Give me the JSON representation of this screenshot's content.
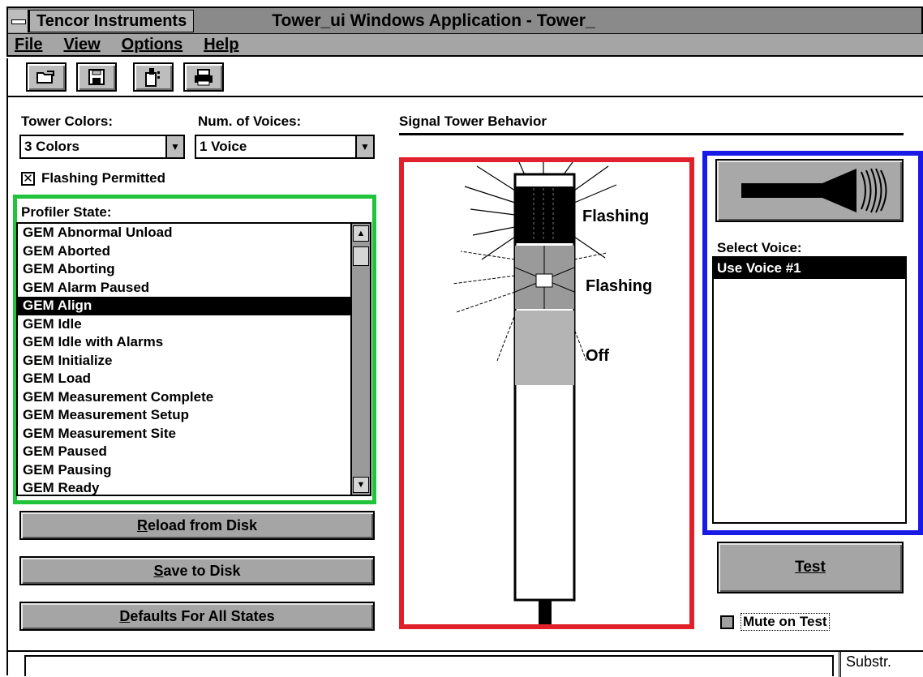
{
  "window": {
    "app_name": "Tencor Instruments",
    "title": "Tower_ui Windows Application - Tower_"
  },
  "menu": [
    "File",
    "View",
    "Options",
    "Help"
  ],
  "toolbar_icons": [
    "open-folder-icon",
    "save-disk-icon",
    "tower-icon",
    "printer-icon"
  ],
  "left": {
    "tower_colors_label": "Tower Colors:",
    "tower_colors_value": "3 Colors",
    "voices_label": "Num. of Voices:",
    "voices_value": "1 Voice",
    "flashing_label": "Flashing Permitted",
    "flashing_checked": true,
    "profiler_label": "Profiler State:",
    "states": [
      "GEM Abnormal Unload",
      "GEM Aborted",
      "GEM Aborting",
      "GEM Alarm Paused",
      "GEM Align",
      "GEM Idle",
      "GEM Idle with Alarms",
      "GEM Initialize",
      "GEM Load",
      "GEM Measurement Complete",
      "GEM Measurement Setup",
      "GEM Measurement Site",
      "GEM Paused",
      "GEM Pausing",
      "GEM Ready"
    ],
    "selected_state": "GEM Align",
    "reload_label_u": "R",
    "reload_label": "eload from Disk",
    "save_label_u": "S",
    "save_label": "ave to Disk",
    "defaults_label_u": "D",
    "defaults_label": "efaults For All States"
  },
  "tower": {
    "section_title": "Signal Tower Behavior",
    "lights": [
      {
        "state": "Flashing",
        "color": "#000000"
      },
      {
        "state": "Flashing",
        "color": "#9a9a9a"
      },
      {
        "state": "Off",
        "color": "#b4b4b4"
      }
    ]
  },
  "voice": {
    "select_label": "Select Voice:",
    "voices": [
      "Use Voice #1"
    ],
    "test_label": "Test",
    "mute_label": "Mute on Test"
  },
  "status": {
    "right_text": "Substr."
  }
}
